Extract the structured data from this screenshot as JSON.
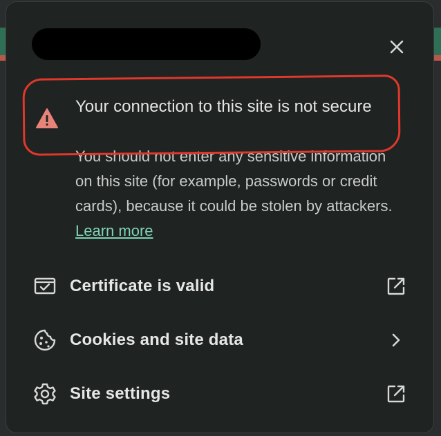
{
  "popup": {
    "close_icon": "close-icon"
  },
  "warning": {
    "icon": "warning-triangle-icon",
    "icon_color": "#e8837a",
    "title": "Your connection to this site is not secure",
    "body": "You should not enter any sensitive information on this site (for example, passwords or credit cards), because it could be stolen by attackers.",
    "learn_more": "Learn more",
    "link_color": "#7fd3b7"
  },
  "rows": [
    {
      "label": "Certificate is valid",
      "icon": "certificate-icon",
      "trail_icon": "external-link-icon"
    },
    {
      "label": "Cookies and site data",
      "icon": "cookie-icon",
      "trail_icon": "chevron-right-icon"
    },
    {
      "label": "Site settings",
      "icon": "gear-icon",
      "trail_icon": "external-link-icon"
    }
  ]
}
